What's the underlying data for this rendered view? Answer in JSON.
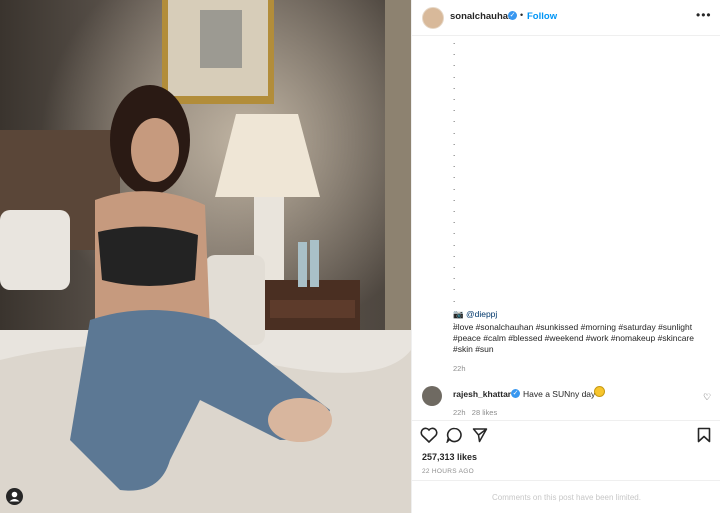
{
  "post": {
    "username": "sonalchauhan",
    "dot": "•",
    "follow_label": "Follow",
    "more_icon": "more-horizontal-icon"
  },
  "caption": {
    "dot_lines": [
      ".",
      ".",
      ".",
      ".",
      ".",
      ".",
      ".",
      ".",
      ".",
      ".",
      ".",
      ".",
      ".",
      ".",
      ".",
      ".",
      ".",
      ".",
      ".",
      ".",
      ".",
      ".",
      ".",
      ".",
      ".",
      "."
    ],
    "credit": "@dieppj",
    "hashtags_line1": "#love #sonalchauhan #sunkissed #morning #saturday #sunlight",
    "hashtags_line2": "#peace #calm #blessed #weekend #work #nomakeup #skincare",
    "hashtags_line3": "#skin #sun",
    "time": "22h"
  },
  "comment": {
    "username": "rajesh_khattar",
    "text": "Have a SUNny day",
    "time": "22h",
    "likes": "28 likes"
  },
  "stats": {
    "likes": "257,313 likes",
    "posted": "22 HOURS AGO"
  },
  "footer": {
    "limited_text": "Comments on this post have been limited."
  },
  "colors": {
    "link_blue": "#0095f6",
    "verified_blue": "#3897f0",
    "hashtag": "#00376b"
  }
}
